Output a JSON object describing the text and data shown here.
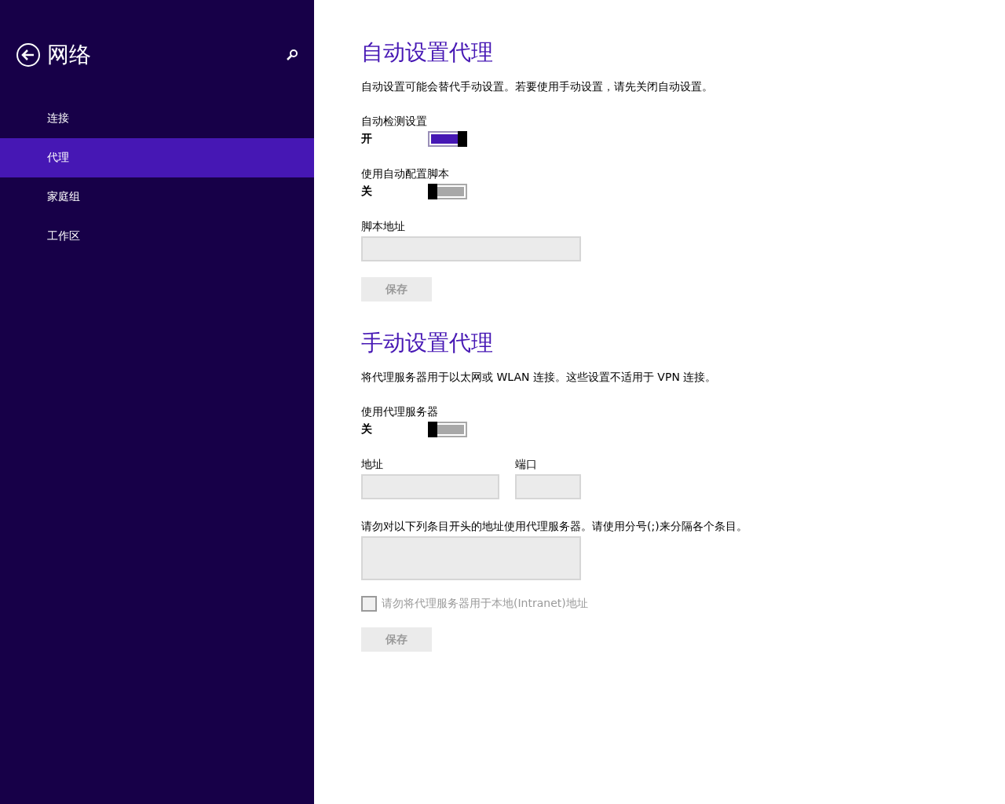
{
  "sidebar": {
    "title": "网络",
    "items": [
      {
        "label": "连接",
        "selected": false
      },
      {
        "label": "代理",
        "selected": true
      },
      {
        "label": "家庭组",
        "selected": false
      },
      {
        "label": "工作区",
        "selected": false
      }
    ]
  },
  "auto_proxy": {
    "heading": "自动设置代理",
    "description": "自动设置可能会替代手动设置。若要使用手动设置，请先关闭自动设置。",
    "toggles": [
      {
        "label": "自动检测设置",
        "state_text": "开",
        "on": true
      },
      {
        "label": "使用自动配置脚本",
        "state_text": "关",
        "on": false
      }
    ],
    "script_address": {
      "label": "脚本地址"
    },
    "save_button": {
      "label": "保存",
      "disabled": true
    }
  },
  "manual_proxy": {
    "heading": "手动设置代理",
    "description": "将代理服务器用于以太网或 WLAN 连接。这些设置不适用于 VPN 连接。",
    "toggle": {
      "label": "使用代理服务器",
      "state_text": "关",
      "on": false
    },
    "address": {
      "label": "地址"
    },
    "port": {
      "label": "端口"
    },
    "exceptions": {
      "label": "请勿对以下列条目开头的地址使用代理服务器。请使用分号(;)来分隔各个条目。"
    },
    "local_checkbox": {
      "label": "请勿将代理服务器用于本地(Intranet)地址",
      "checked": false,
      "disabled": true
    },
    "save_button": {
      "label": "保存",
      "disabled": true
    }
  }
}
